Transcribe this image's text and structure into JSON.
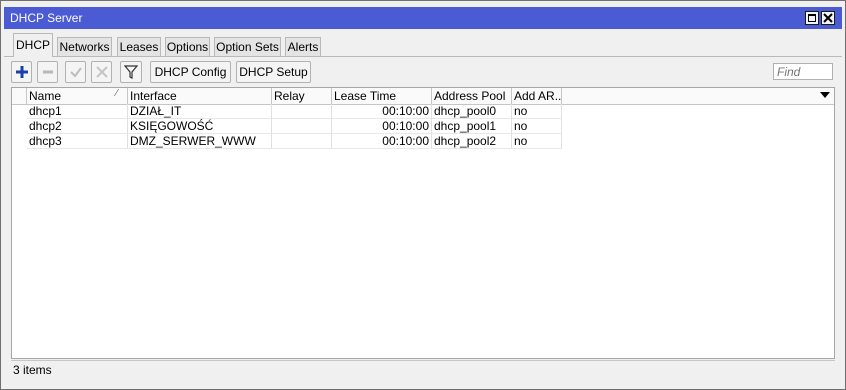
{
  "window": {
    "title": "DHCP Server"
  },
  "tabs": [
    "DHCP",
    "Networks",
    "Leases",
    "Options",
    "Option Sets",
    "Alerts"
  ],
  "toolbar": {
    "dhcp_config_label": "DHCP Config",
    "dhcp_setup_label": "DHCP Setup",
    "find_placeholder": "Find"
  },
  "table": {
    "columns": [
      "Name",
      "Interface",
      "Relay",
      "Lease Time",
      "Address Pool",
      "Add AR..."
    ],
    "rows": [
      [
        "dhcp1",
        "DZIAŁ_IT",
        "",
        "00:10:00",
        "dhcp_pool0",
        "no"
      ],
      [
        "dhcp2",
        "KSIĘGOWOŚĆ",
        "",
        "00:10:00",
        "dhcp_pool1",
        "no"
      ],
      [
        "dhcp3",
        "DMZ_SERWER_WWW",
        "",
        "00:10:00",
        "dhcp_pool2",
        "no"
      ]
    ]
  },
  "status": {
    "count_text": "3 items"
  },
  "colors": {
    "titlebar": "#4a5bd4",
    "add_icon": "#1a3fa8"
  }
}
